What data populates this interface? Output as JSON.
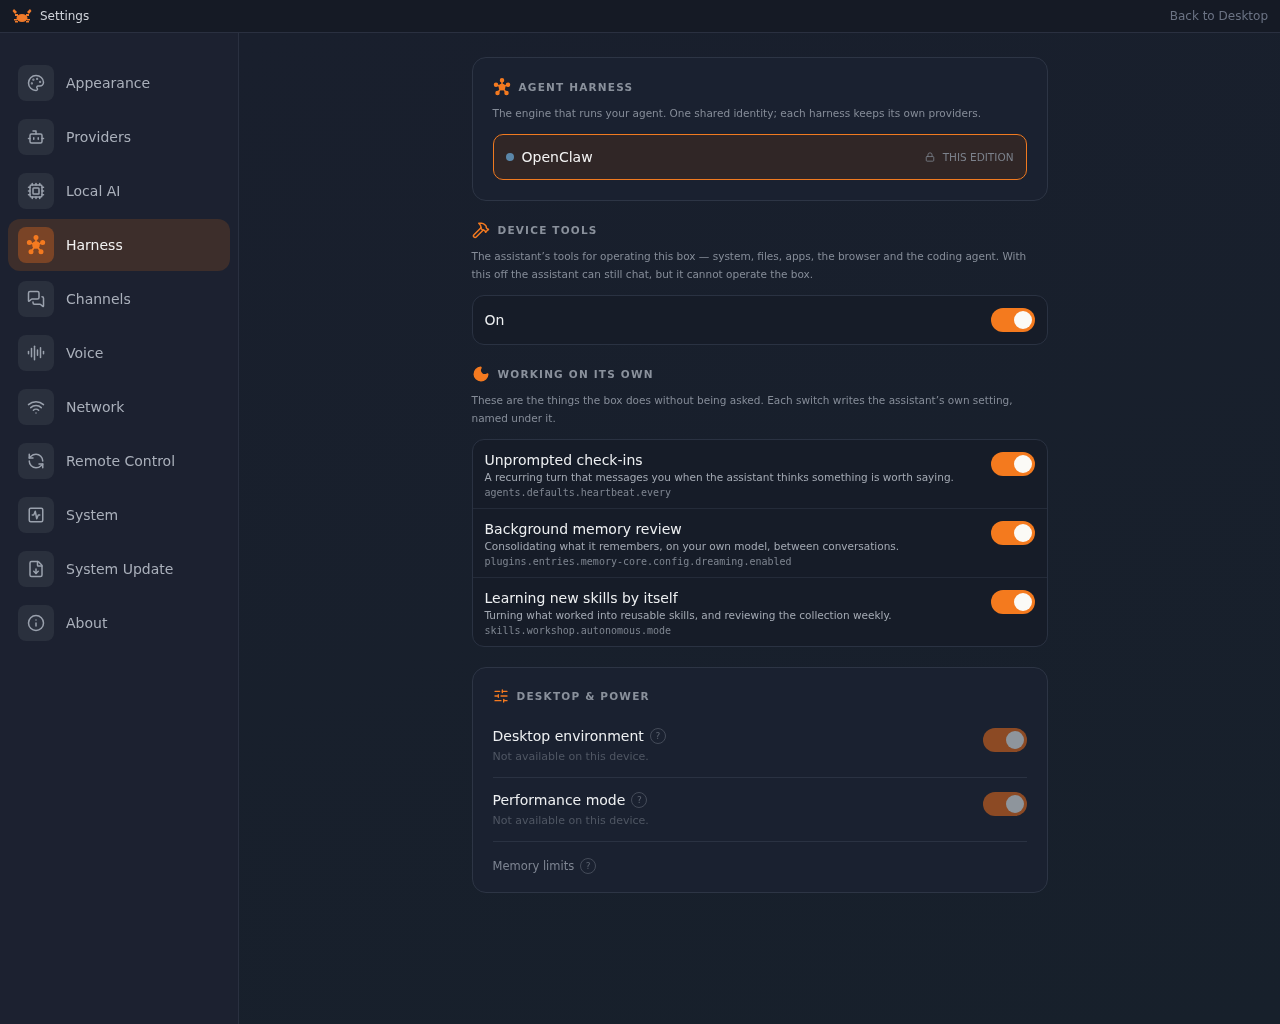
{
  "window": {
    "title": "Settings",
    "back_link": "Back to Desktop"
  },
  "sidebar": {
    "items": [
      {
        "label": "Appearance",
        "selected": false
      },
      {
        "label": "Providers",
        "selected": false
      },
      {
        "label": "Local AI",
        "selected": false
      },
      {
        "label": "Harness",
        "selected": true
      },
      {
        "label": "Channels",
        "selected": false
      },
      {
        "label": "Voice",
        "selected": false
      },
      {
        "label": "Network",
        "selected": false
      },
      {
        "label": "Remote Control",
        "selected": false
      },
      {
        "label": "System",
        "selected": false
      },
      {
        "label": "System Update",
        "selected": false
      },
      {
        "label": "About",
        "selected": false
      }
    ]
  },
  "agent_harness": {
    "heading": "AGENT HARNESS",
    "description": "The engine that runs your agent. One shared identity; each harness keeps its own providers.",
    "option": {
      "name": "OpenClaw",
      "badge": "THIS EDITION",
      "selected": true
    }
  },
  "device_tools": {
    "heading": "DEVICE TOOLS",
    "description": "The assistant’s tools for operating this box — system, files, apps, the browser and the coding agent. With this off the assistant can still chat, but it cannot operate the box.",
    "toggle": {
      "label": "On",
      "on": true
    }
  },
  "working_on_its_own": {
    "heading": "WORKING ON ITS OWN",
    "description": "These are the things the box does without being asked. Each switch writes the assistant’s own setting, named under it.",
    "rows": [
      {
        "title": "Unprompted check-ins",
        "description": "A recurring turn that messages you when the assistant thinks something is worth saying.",
        "key": "agents.defaults.heartbeat.every",
        "on": true
      },
      {
        "title": "Background memory review",
        "description": "Consolidating what it remembers, on your own model, between conversations.",
        "key": "plugins.entries.memory-core.config.dreaming.enabled",
        "on": true
      },
      {
        "title": "Learning new skills by itself",
        "description": "Turning what worked into reusable skills, and reviewing the collection weekly.",
        "key": "skills.workshop.autonomous.mode",
        "on": true
      }
    ]
  },
  "desktop_power": {
    "heading": "DESKTOP & POWER",
    "rows": [
      {
        "kind": "toggle",
        "title": "Desktop environment",
        "help": "?",
        "note": "Not available on this device.",
        "on": true,
        "disabled": true
      },
      {
        "kind": "toggle",
        "title": "Performance mode",
        "help": "?",
        "note": "Not available on this device.",
        "on": true,
        "disabled": true
      },
      {
        "kind": "link",
        "title": "Memory limits",
        "help": "?"
      }
    ]
  }
}
